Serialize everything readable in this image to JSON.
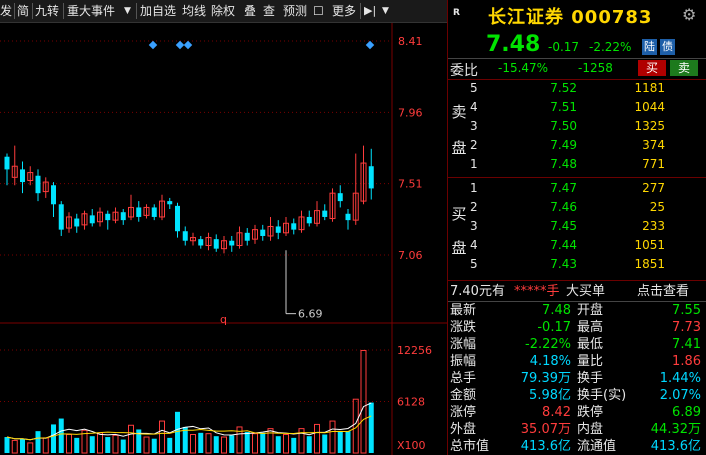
{
  "toolbar": {
    "items": [
      "发",
      "简",
      "九转",
      "重大事件",
      "▼",
      "加自选",
      "均线",
      "除权",
      "叠",
      "查",
      "预测",
      "☐",
      "更多",
      "▶|",
      "▼"
    ]
  },
  "chart": {
    "price_ticks": [
      "8.41",
      "7.96",
      "7.51",
      "7.06"
    ],
    "low_label": "6.69",
    "q_marker": "q",
    "volume_ticks": [
      "12256",
      "6128",
      "X100"
    ],
    "colors": {
      "up": "#ff3c3c",
      "down": "#00e4ff",
      "ma": "#ffffff",
      "ma2": "#ffd700",
      "grid": "#7a0000",
      "axis": "#ff3c3c"
    },
    "candles": [
      {
        "o": 7.68,
        "c": 7.6,
        "h": 7.7,
        "l": 7.5,
        "v": 1900
      },
      {
        "o": 7.55,
        "c": 7.62,
        "h": 7.75,
        "l": 7.5,
        "v": 1500
      },
      {
        "o": 7.6,
        "c": 7.52,
        "h": 7.65,
        "l": 7.45,
        "v": 1700
      },
      {
        "o": 7.53,
        "c": 7.58,
        "h": 7.62,
        "l": 7.5,
        "v": 1200
      },
      {
        "o": 7.56,
        "c": 7.45,
        "h": 7.6,
        "l": 7.4,
        "v": 2600
      },
      {
        "o": 7.46,
        "c": 7.52,
        "h": 7.55,
        "l": 7.42,
        "v": 1800
      },
      {
        "o": 7.5,
        "c": 7.38,
        "h": 7.52,
        "l": 7.3,
        "v": 3400
      },
      {
        "o": 7.38,
        "c": 7.22,
        "h": 7.4,
        "l": 7.18,
        "v": 4100
      },
      {
        "o": 7.23,
        "c": 7.3,
        "h": 7.33,
        "l": 7.2,
        "v": 2200
      },
      {
        "o": 7.29,
        "c": 7.24,
        "h": 7.32,
        "l": 7.2,
        "v": 1800
      },
      {
        "o": 7.25,
        "c": 7.32,
        "h": 7.34,
        "l": 7.22,
        "v": 2700
      },
      {
        "o": 7.31,
        "c": 7.26,
        "h": 7.35,
        "l": 7.24,
        "v": 2000
      },
      {
        "o": 7.27,
        "c": 7.33,
        "h": 7.36,
        "l": 7.24,
        "v": 2400
      },
      {
        "o": 7.32,
        "c": 7.28,
        "h": 7.34,
        "l": 7.22,
        "v": 1900
      },
      {
        "o": 7.28,
        "c": 7.33,
        "h": 7.36,
        "l": 7.26,
        "v": 2100
      },
      {
        "o": 7.33,
        "c": 7.28,
        "h": 7.35,
        "l": 7.25,
        "v": 1600
      },
      {
        "o": 7.3,
        "c": 7.36,
        "h": 7.44,
        "l": 7.28,
        "v": 3300
      },
      {
        "o": 7.36,
        "c": 7.3,
        "h": 7.4,
        "l": 7.27,
        "v": 2800
      },
      {
        "o": 7.31,
        "c": 7.36,
        "h": 7.38,
        "l": 7.29,
        "v": 1900
      },
      {
        "o": 7.36,
        "c": 7.3,
        "h": 7.38,
        "l": 7.28,
        "v": 1700
      },
      {
        "o": 7.3,
        "c": 7.4,
        "h": 7.44,
        "l": 7.28,
        "v": 3800
      },
      {
        "o": 7.4,
        "c": 7.38,
        "h": 7.42,
        "l": 7.35,
        "v": 1800
      },
      {
        "o": 7.37,
        "c": 7.21,
        "h": 7.39,
        "l": 7.17,
        "v": 4900
      },
      {
        "o": 7.21,
        "c": 7.15,
        "h": 7.24,
        "l": 7.12,
        "v": 3100
      },
      {
        "o": 7.15,
        "c": 7.17,
        "h": 7.2,
        "l": 7.12,
        "v": 2200
      },
      {
        "o": 7.16,
        "c": 7.12,
        "h": 7.18,
        "l": 7.1,
        "v": 2400
      },
      {
        "o": 7.12,
        "c": 7.17,
        "h": 7.2,
        "l": 7.09,
        "v": 2300
      },
      {
        "o": 7.16,
        "c": 7.1,
        "h": 7.19,
        "l": 7.08,
        "v": 2000
      },
      {
        "o": 7.1,
        "c": 7.15,
        "h": 7.18,
        "l": 7.07,
        "v": 1900
      },
      {
        "o": 7.15,
        "c": 7.12,
        "h": 7.18,
        "l": 7.08,
        "v": 2100
      },
      {
        "o": 7.12,
        "c": 7.2,
        "h": 7.24,
        "l": 7.1,
        "v": 3100
      },
      {
        "o": 7.2,
        "c": 7.15,
        "h": 7.23,
        "l": 7.12,
        "v": 2500
      },
      {
        "o": 7.16,
        "c": 7.22,
        "h": 7.25,
        "l": 7.13,
        "v": 2300
      },
      {
        "o": 7.22,
        "c": 7.18,
        "h": 7.25,
        "l": 7.15,
        "v": 2400
      },
      {
        "o": 7.18,
        "c": 7.24,
        "h": 7.3,
        "l": 7.15,
        "v": 2900
      },
      {
        "o": 7.24,
        "c": 7.2,
        "h": 7.28,
        "l": 7.16,
        "v": 2000
      },
      {
        "o": 7.2,
        "c": 7.26,
        "h": 7.3,
        "l": 7.18,
        "v": 2200
      },
      {
        "o": 7.26,
        "c": 7.22,
        "h": 7.29,
        "l": 7.19,
        "v": 1800
      },
      {
        "o": 7.22,
        "c": 7.3,
        "h": 7.34,
        "l": 7.2,
        "v": 2900
      },
      {
        "o": 7.3,
        "c": 7.26,
        "h": 7.34,
        "l": 7.24,
        "v": 2000
      },
      {
        "o": 7.26,
        "c": 7.34,
        "h": 7.4,
        "l": 7.24,
        "v": 3400
      },
      {
        "o": 7.34,
        "c": 7.3,
        "h": 7.38,
        "l": 7.28,
        "v": 2200
      },
      {
        "o": 7.29,
        "c": 7.45,
        "h": 7.48,
        "l": 7.27,
        "v": 3800
      },
      {
        "o": 7.45,
        "c": 7.4,
        "h": 7.5,
        "l": 7.36,
        "v": 2600
      },
      {
        "o": 7.32,
        "c": 7.28,
        "h": 7.35,
        "l": 7.22,
        "v": 2600
      },
      {
        "o": 7.28,
        "c": 7.45,
        "h": 7.7,
        "l": 7.25,
        "v": 6400
      },
      {
        "o": 7.4,
        "c": 7.64,
        "h": 7.75,
        "l": 7.38,
        "v": 12200
      },
      {
        "o": 7.62,
        "c": 7.48,
        "h": 7.73,
        "l": 7.41,
        "v": 6000
      }
    ]
  },
  "quote": {
    "badge": "R",
    "title": "长江证券 000783",
    "price": "7.48",
    "change": "-0.17",
    "change_pct": "-2.22%",
    "tag1": "陆",
    "tag2": "债",
    "weibi_label": "委比",
    "weibi_pct": "-15.47%",
    "weibi_diff": "-1258",
    "buy_btn": "买",
    "sell_btn": "卖",
    "sell_side": [
      "卖",
      "盘"
    ],
    "buy_side": [
      "买",
      "盘"
    ],
    "sells": [
      {
        "lvl": "5",
        "price": "7.52",
        "vol": "1181"
      },
      {
        "lvl": "4",
        "price": "7.51",
        "vol": "1044"
      },
      {
        "lvl": "3",
        "price": "7.50",
        "vol": "1325"
      },
      {
        "lvl": "2",
        "price": "7.49",
        "vol": "374"
      },
      {
        "lvl": "1",
        "price": "7.48",
        "vol": "771"
      }
    ],
    "buys": [
      {
        "lvl": "1",
        "price": "7.47",
        "vol": "277"
      },
      {
        "lvl": "2",
        "price": "7.46",
        "vol": "25"
      },
      {
        "lvl": "3",
        "price": "7.45",
        "vol": "233"
      },
      {
        "lvl": "4",
        "price": "7.44",
        "vol": "1051"
      },
      {
        "lvl": "5",
        "price": "7.43",
        "vol": "1851"
      }
    ],
    "bigorder": {
      "price": "7.40元有",
      "stars": "*****手",
      "label": "大买单",
      "link": "点击查看"
    },
    "stats": [
      {
        "l1": "最新",
        "v1": "7.48",
        "c1": "g",
        "l2": "开盘",
        "v2": "7.55",
        "c2": "g"
      },
      {
        "l1": "涨跌",
        "v1": "-0.17",
        "c1": "g",
        "l2": "最高",
        "v2": "7.73",
        "c2": "r"
      },
      {
        "l1": "涨幅",
        "v1": "-2.22%",
        "c1": "g",
        "l2": "最低",
        "v2": "7.41",
        "c2": "g"
      },
      {
        "l1": "振幅",
        "v1": "4.18%",
        "c1": "c",
        "l2": "量比",
        "v2": "1.86",
        "c2": "r"
      },
      {
        "l1": "总手",
        "v1": "79.39万",
        "c1": "c",
        "l2": "换手",
        "v2": "1.44%",
        "c2": "c"
      },
      {
        "l1": "金额",
        "v1": "5.98亿",
        "c1": "c",
        "l2": "换手(实)",
        "v2": "2.07%",
        "c2": "c"
      },
      {
        "l1": "涨停",
        "v1": "8.42",
        "c1": "r",
        "l2": "跌停",
        "v2": "6.89",
        "c2": "g"
      },
      {
        "l1": "外盘",
        "v1": "35.07万",
        "c1": "r",
        "l2": "内盘",
        "v2": "44.32万",
        "c2": "g"
      },
      {
        "l1": "总市值",
        "v1": "413.6亿",
        "c1": "c",
        "l2": "流通值",
        "v2": "413.6亿",
        "c2": "c"
      }
    ]
  }
}
